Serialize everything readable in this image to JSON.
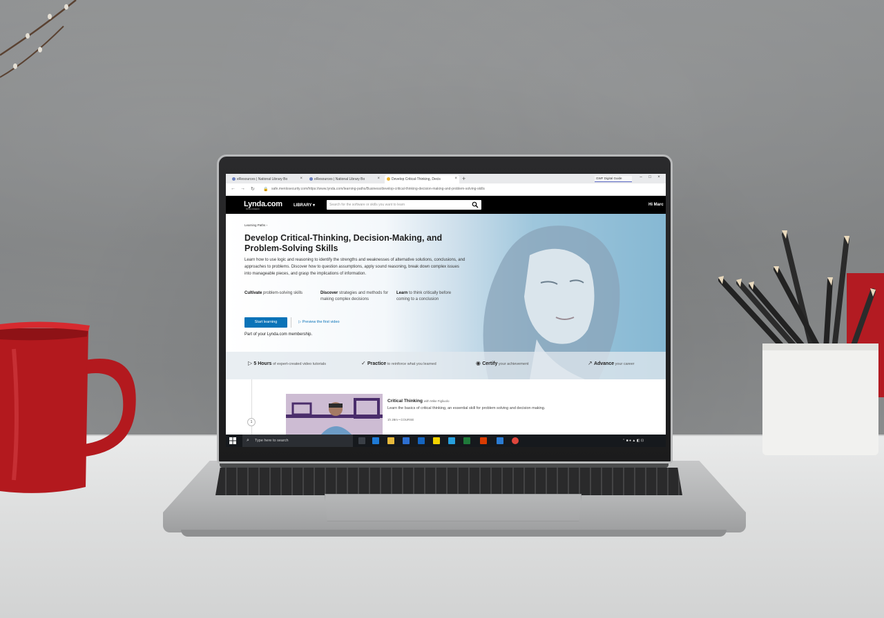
{
  "browser": {
    "tabs": [
      {
        "title": "eResources | National Library Bo",
        "active": false
      },
      {
        "title": "eResources | National Library Bo",
        "active": false
      },
      {
        "title": "Develop Critical-Thinking, Decis",
        "active": true
      }
    ],
    "new_tab_glyph": "+",
    "extension_label": "GWF Digital Guide",
    "url": "safe.menlosecurity.com/https://www.lynda.com/learning-paths/Business/develop-critical-thinking-decision-making-and-problem-solving-skills"
  },
  "site_header": {
    "logo": "Lynda.com",
    "logo_sub": "FROM LINKEDIN",
    "library_label": "LIBRARY",
    "search_placeholder": "Search for the software or skills you want to learn",
    "greeting": "Hi Marc"
  },
  "hero": {
    "breadcrumb": "Learning Paths",
    "title": "Develop Critical-Thinking, Decision-Making, and Problem-Solving Skills",
    "description": "Learn how to use logic and reasoning to identify the strengths and weaknesses of alternative solutions, conclusions, and approaches to problems. Discover how to question assumptions, apply sound reasoning, break down complex issues into manageable pieces, and grasp the implications of information.",
    "features": [
      {
        "bold": "Cultivate",
        "rest": " problem-solving skills"
      },
      {
        "bold": "Discover",
        "rest": " strategies and methods for making complex decisions"
      },
      {
        "bold": "Learn",
        "rest": " to think critically before coming to a conclusion"
      }
    ],
    "start_button": "Start learning",
    "preview_button": "Preview the first video",
    "membership_note": "Part of your Lynda.com membership."
  },
  "benefits": [
    {
      "bold": "5 Hours",
      "rest": " of expert-created video tutorials",
      "icon": "play-icon"
    },
    {
      "bold": "Practice",
      "rest": " to reinforce what you learned",
      "icon": "check-icon"
    },
    {
      "bold": "Certify",
      "rest": " your achievement",
      "icon": "badge-icon"
    },
    {
      "bold": "Advance",
      "rest": " your career",
      "icon": "arrow-up-icon"
    }
  ],
  "course": {
    "step": "1",
    "title": "Critical Thinking",
    "author": "with Mike Figliuolo",
    "description": "Learn the basics of critical thinking, an essential skill for problem solving and decision making.",
    "meta": "1h 28m • COURSE"
  },
  "taskbar": {
    "search_placeholder": "Type here to search"
  },
  "colors": {
    "accent": "#0a73b8",
    "header_bg": "#000000",
    "taskbar_bg": "#16191d"
  }
}
